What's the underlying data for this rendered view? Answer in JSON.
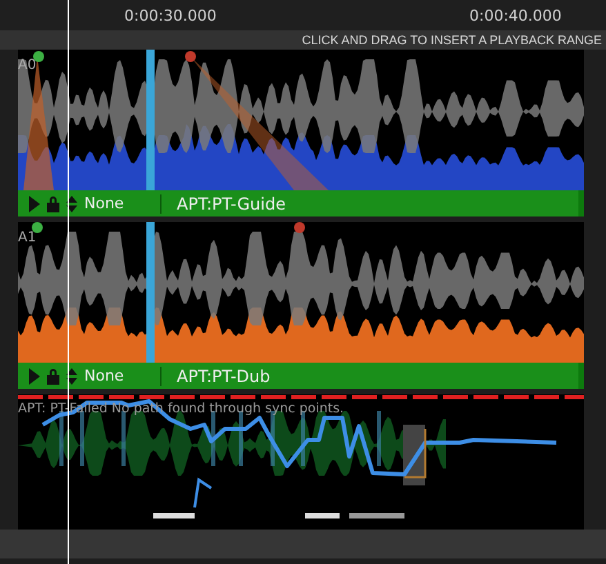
{
  "ruler": {
    "ticks": [
      "0:00:30.000",
      "0:00:40.000"
    ]
  },
  "hint": "CLICK AND DRAG TO INSERT A PLAYBACK RANGE",
  "tracks": [
    {
      "label": "A0",
      "color": "#2346c4",
      "mode": "None",
      "name": "APT:PT-Guide"
    },
    {
      "label": "A1",
      "color": "#e0681e",
      "mode": "None",
      "name": "APT:PT-Dub"
    }
  ],
  "analysis": {
    "message": "APT: PT-Failed No path found through sync points."
  }
}
